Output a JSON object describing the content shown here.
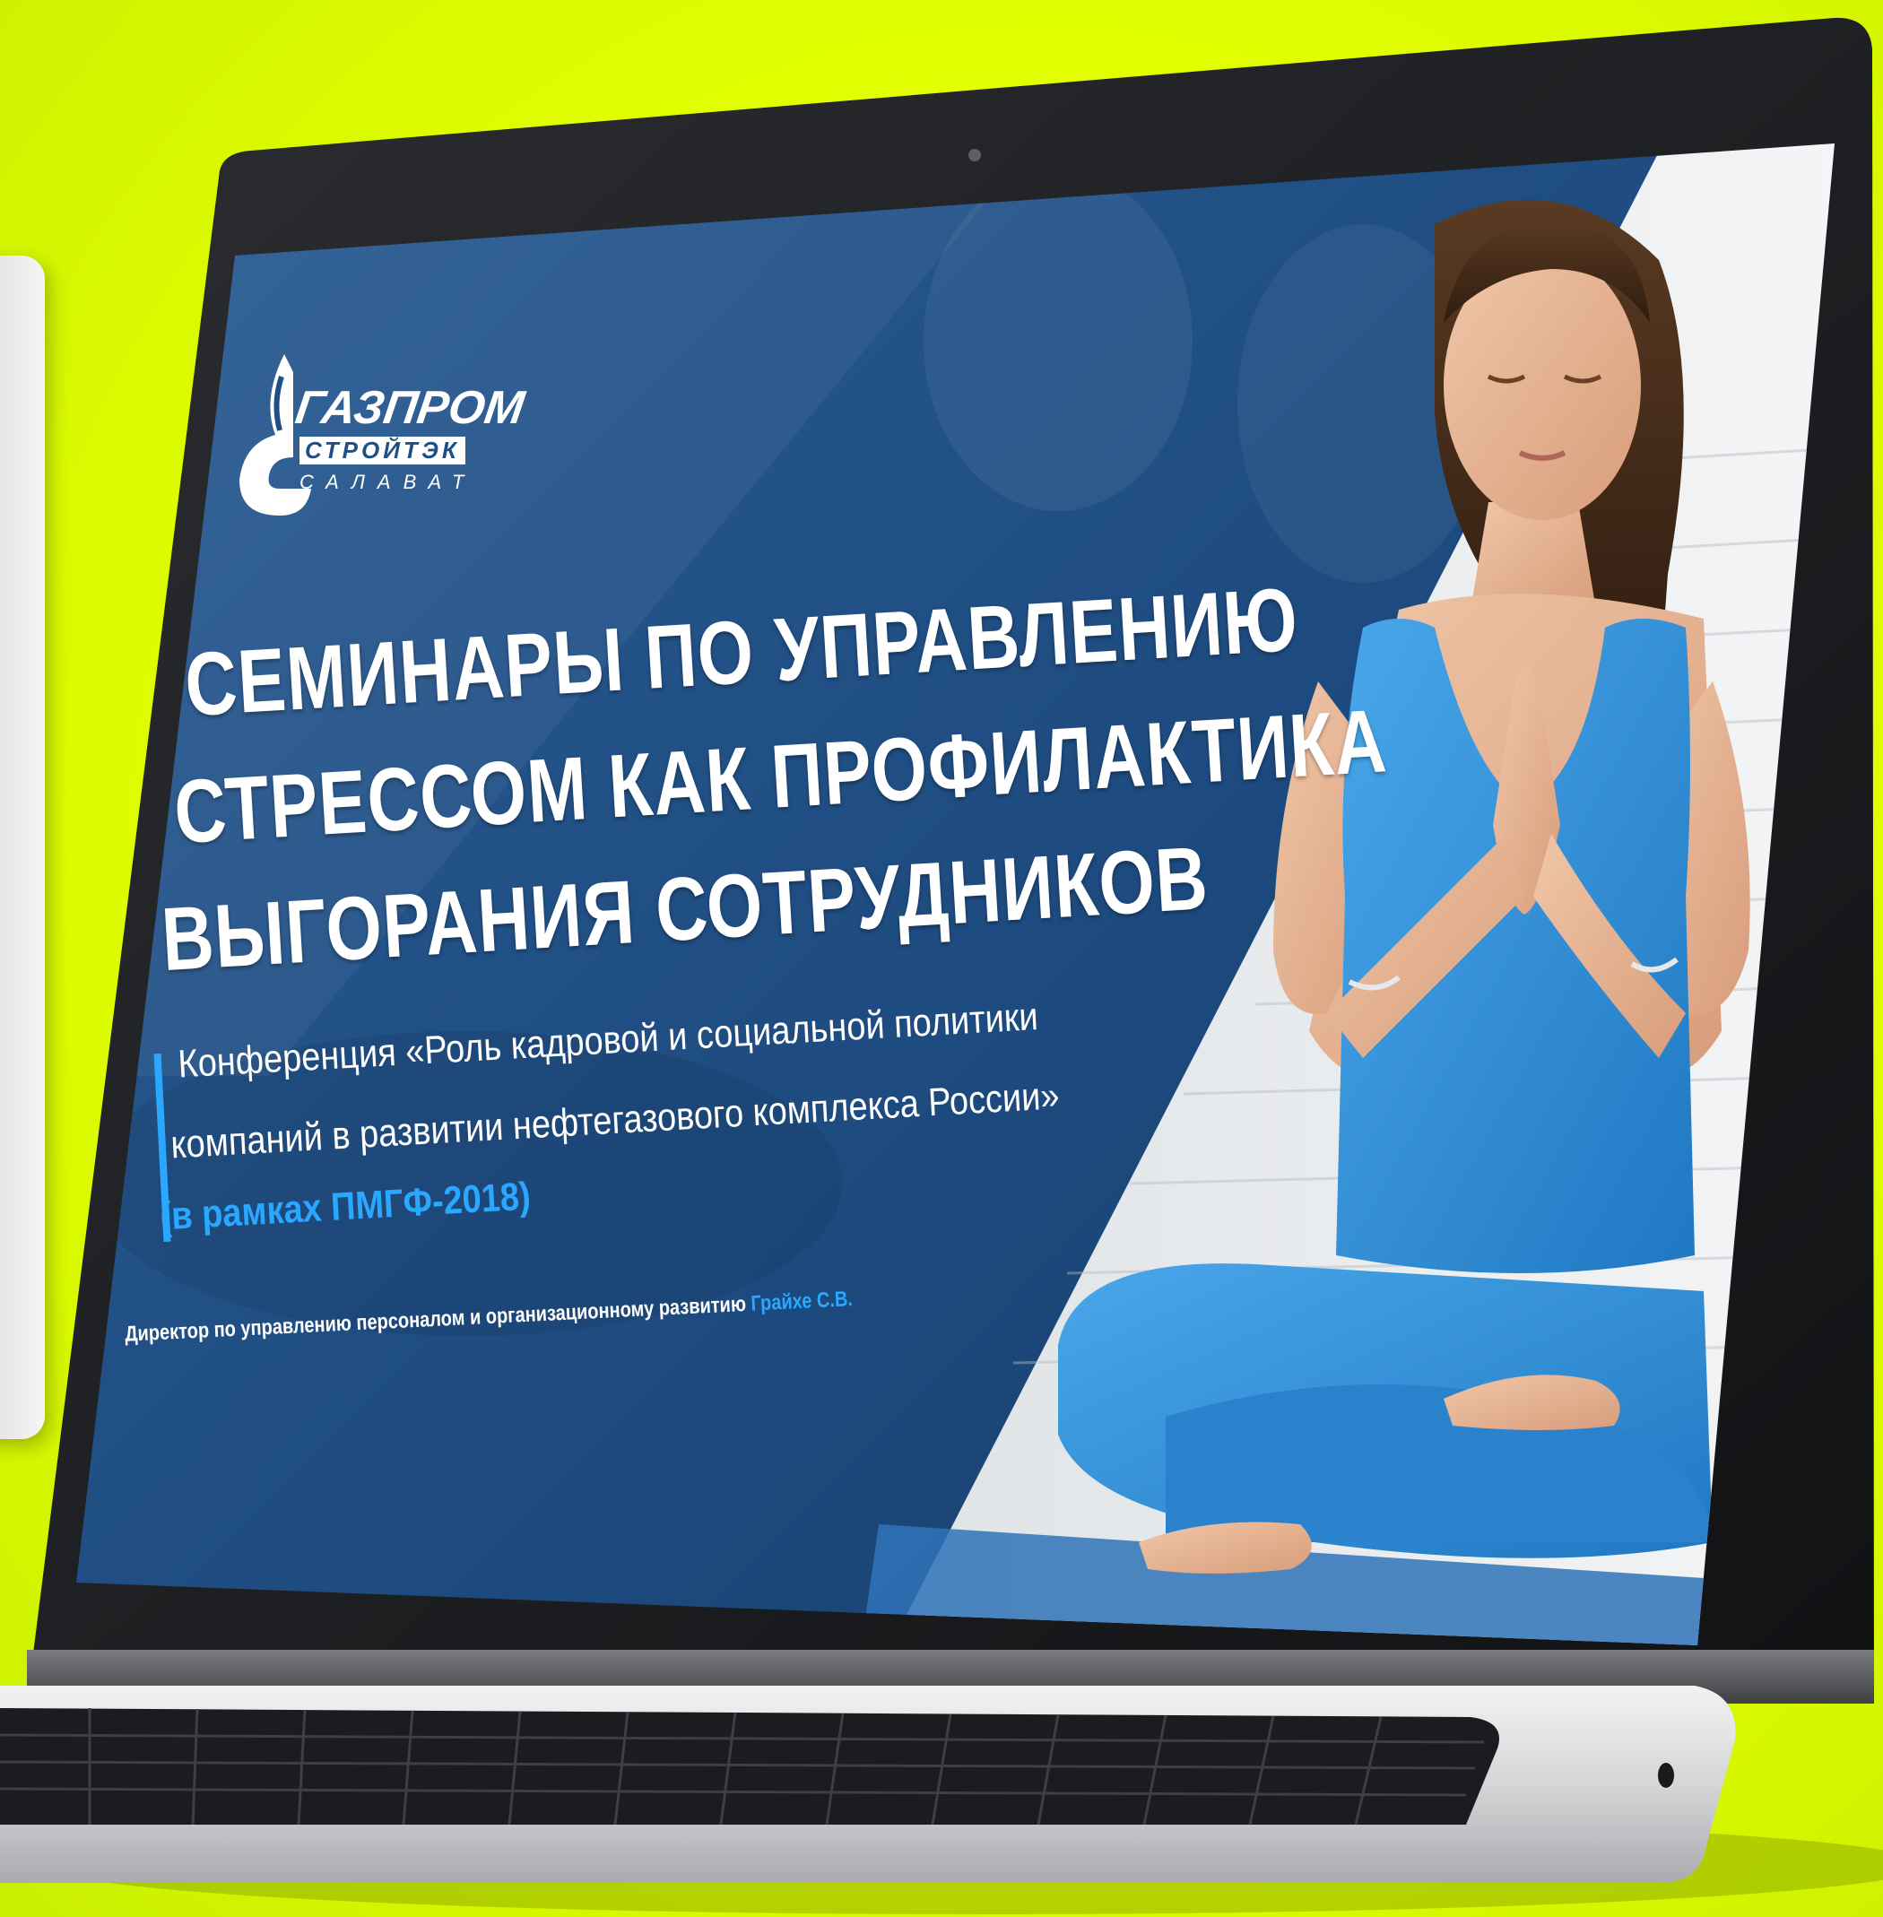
{
  "slide": {
    "logo": {
      "line1": "ГАЗПРОМ",
      "line2": "СТРОЙТЭК",
      "line3": "САЛАВАТ"
    },
    "title_lines": [
      "СЕМИНАРЫ ПО УПРАВЛЕНИЮ",
      "СТРЕССОМ КАК ПРОФИЛАКТИКА",
      "ВЫГОРАНИЯ СОТРУДНИКОВ"
    ],
    "conference_lines": [
      "Конференция «Роль кадровой и социальной политики",
      "компаний в развитии нефтегазового комплекса России»"
    ],
    "conference_note": "(в рамках ПМГФ-2018)",
    "director_role": "Директор по управлению персоналом и организационному развитию",
    "director_name": "Грайхе С.В."
  },
  "colors": {
    "background": "#e6ff00",
    "slide_blue": "#1e4f86",
    "accent": "#2aa7ff",
    "outfit": "#2f8fd6"
  }
}
